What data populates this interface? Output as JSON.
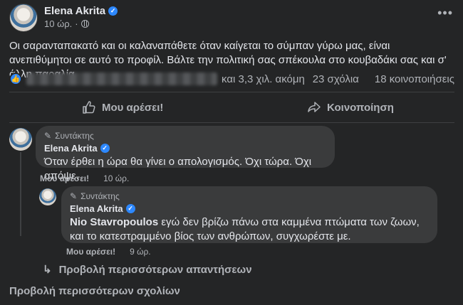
{
  "post": {
    "author": "Elena Akrita",
    "time": "10 ώρ.",
    "text": "Οι σαρανταπακατό και οι καλαναπάθετε όταν καίγεται το σύμπαν γύρω μας, είναι ανεπιθύμητοι σε αυτό το προφίλ. Βάλτε την πολιτική σας σπέκουλα στο κουβαδάκι σας και σ' άλλη παραλία."
  },
  "reactions": {
    "others": "και 3,3 χιλ. ακόμη",
    "comments": "23 σχόλια",
    "shares": "18 κοινοποιήσεις"
  },
  "actions": {
    "like": "Μου αρέσει!",
    "share": "Κοινοποίηση"
  },
  "comments": [
    {
      "role": "Συντάκτης",
      "name": "Elena Akrita",
      "text": "Όταν έρθει η ώρα θα γίνει ο απολογισμός. Όχι τώρα. Όχι απόψε.",
      "like": "Μου αρέσει!",
      "time": "10 ώρ."
    },
    {
      "role": "Συντάκτης",
      "name": "Elena Akrita",
      "mention": "Nio Stavropoulos",
      "text": " εγώ δεν βρίζω πάνω στα καμμένα πτώματα των ζωων, και το κατεστραμμένο βίος των ανθρώπων, συγχωρέστε με.",
      "like": "Μου αρέσει!",
      "time": "9 ώρ."
    }
  ],
  "more_replies": "Προβολή περισσότερων απαντήσεων",
  "more_comments": "Προβολή περισσότερων σχολίων"
}
